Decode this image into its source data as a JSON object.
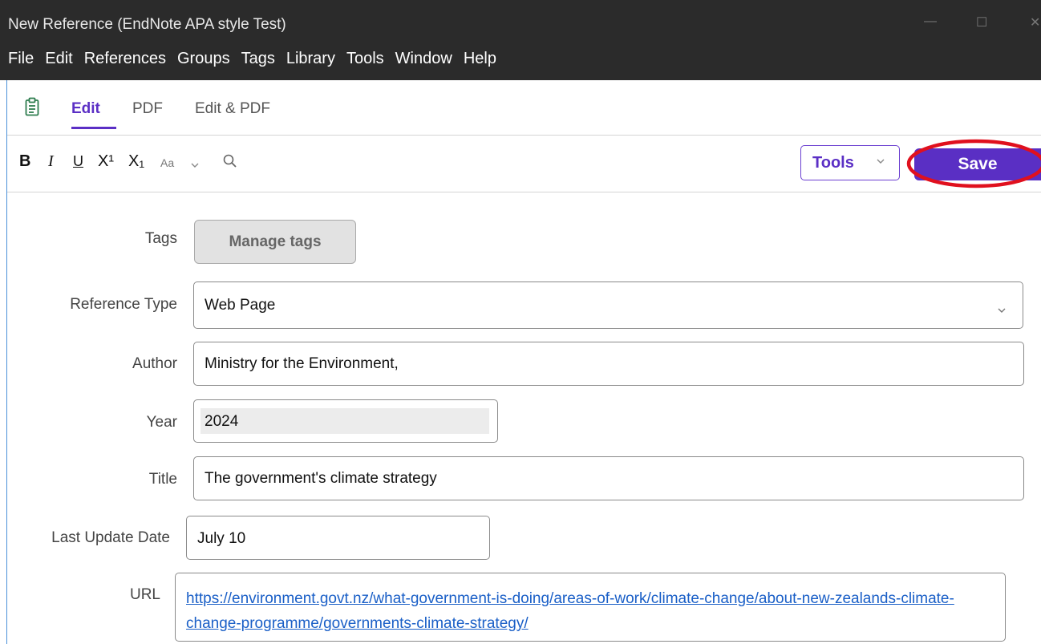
{
  "window": {
    "title": "New Reference (EndNote APA style Test)",
    "minimize": "—",
    "maximize": "☐",
    "close": "✕"
  },
  "menu": [
    "File",
    "Edit",
    "References",
    "Groups",
    "Tags",
    "Library",
    "Tools",
    "Window",
    "Help"
  ],
  "view_tabs": {
    "edit": "Edit",
    "pdf": "PDF",
    "edit_pdf": "Edit & PDF",
    "active": "Edit"
  },
  "format_toolbar": {
    "bold": "B",
    "italic": "I",
    "underline": "U",
    "superscript": "X¹",
    "subscript": "X₁",
    "font_size": "Aa",
    "tools_label": "Tools",
    "save_label": "Save"
  },
  "form": {
    "tags_label": "Tags",
    "manage_tags_label": "Manage tags",
    "reference_type_label": "Reference Type",
    "reference_type_value": "Web Page",
    "author_label": "Author",
    "author_value": "Ministry for the Environment,",
    "year_label": "Year",
    "year_value": "2024",
    "title_label": "Title",
    "title_value": "The government's climate strategy",
    "last_update_label": "Last Update Date",
    "last_update_value": "July 10",
    "url_label": "URL",
    "url_value": "https://environment.govt.nz/what-government-is-doing/areas-of-work/climate-change/about-new-zealands-climate-change-programme/governments-climate-strategy/"
  },
  "colors": {
    "accent": "#5a2fc4",
    "titlebar": "#2b2b2b",
    "highlight_circle": "#e0101e",
    "link": "#1a5fc7"
  },
  "icons": [
    "clipboard-icon",
    "search-icon",
    "chevron-down-icon"
  ]
}
